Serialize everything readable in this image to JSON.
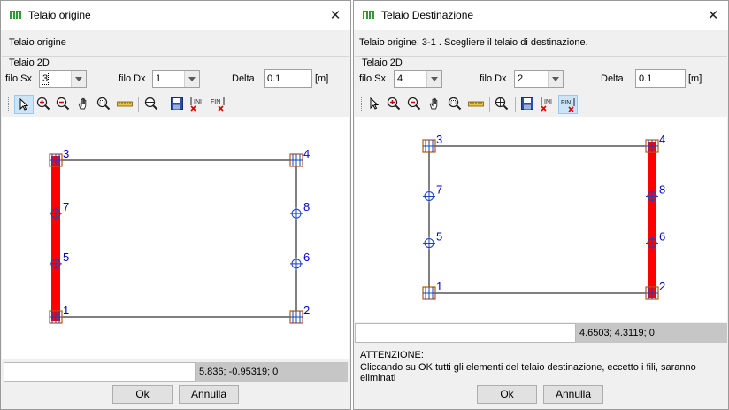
{
  "left_window": {
    "title": "Telaio origine",
    "header": "Telaio origine",
    "group_label": "Telaio 2D",
    "filo_sx_label": "filo Sx",
    "filo_sx_value": "3",
    "filo_dx_label": "filo Dx",
    "filo_dx_value": "1",
    "delta_label": "Delta",
    "delta_value": "0.1",
    "unit": "[m]",
    "node_labels": [
      "3",
      "4",
      "7",
      "8",
      "5",
      "6",
      "1",
      "2"
    ],
    "highlighted_edge": "left",
    "coord_readout": "5.836; -0.95319; 0",
    "ok_label": "Ok",
    "cancel_label": "Annulla"
  },
  "right_window": {
    "title": "Telaio Destinazione",
    "header": "Telaio origine: 3-1 . Scegliere il telaio di destinazione.",
    "group_label": "Telaio 2D",
    "filo_sx_label": "filo Sx",
    "filo_sx_value": "4",
    "filo_dx_label": "filo Dx",
    "filo_dx_value": "2",
    "delta_label": "Delta",
    "delta_value": "0.1",
    "unit": "[m]",
    "node_labels": [
      "3",
      "4",
      "7",
      "8",
      "5",
      "6",
      "1",
      "2"
    ],
    "highlighted_edge": "right",
    "coord_readout": "4.6503; 4.3119; 0",
    "warning_title": "ATTENZIONE:",
    "warning_text": "Cliccando su OK tutti gli elementi del telaio destinazione, eccetto i fili, saranno eliminati",
    "ok_label": "Ok",
    "cancel_label": "Annulla"
  },
  "toolbar_icons": [
    "pointer-icon",
    "zoom-in-icon",
    "zoom-out-icon",
    "pan-hand-icon",
    "zoom-window-icon",
    "measure-ruler-icon",
    "zoom-extents-icon",
    "save-icon",
    "clear-ini-icon",
    "clear-fin-icon"
  ],
  "toolbar_text": {
    "ini": "INI",
    "fin": "FIN"
  },
  "colors": {
    "beam_highlight": "#ff0000",
    "node_label": "#0000cc",
    "node_marker": "#b05a1a",
    "pressed_button": "#cce4f7",
    "status_gray": "#c6c6c6"
  }
}
